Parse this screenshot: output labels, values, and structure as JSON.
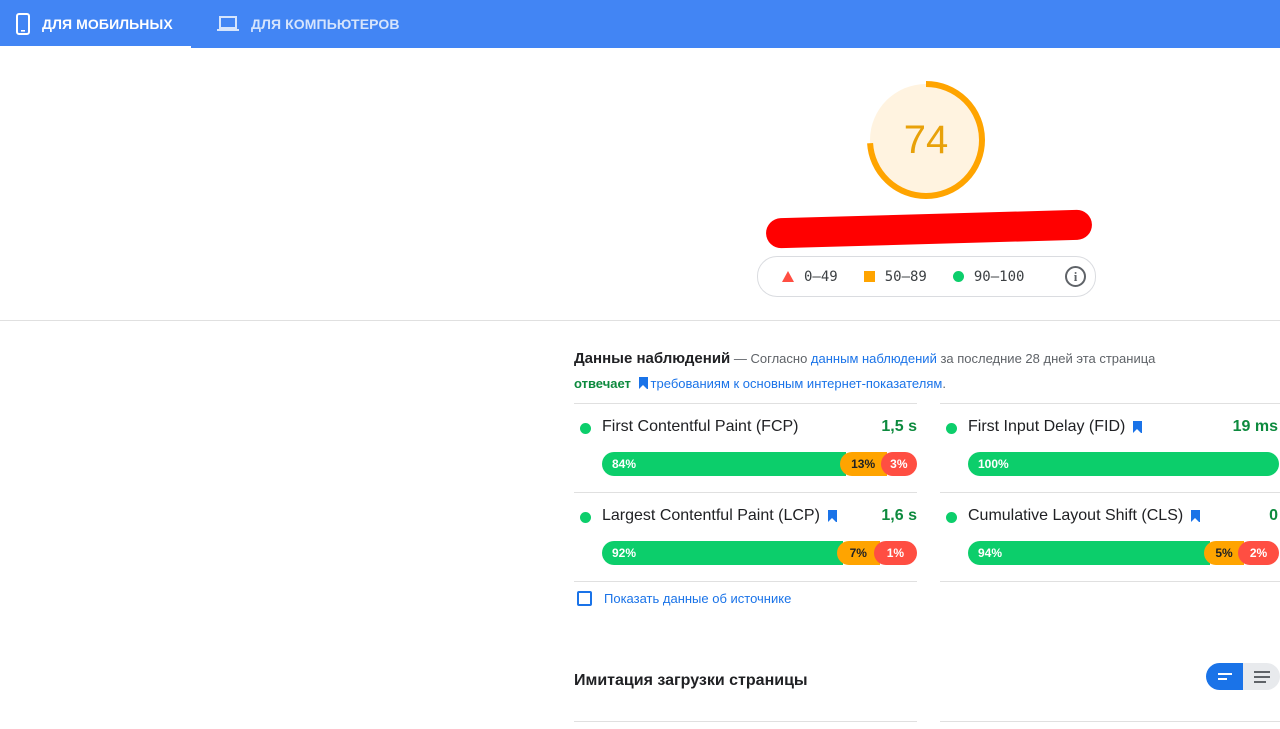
{
  "tabs": {
    "mobile_label": "ДЛЯ МОБИЛЬНЫХ",
    "desktop_label": "ДЛЯ КОМПЬЮТЕРОВ"
  },
  "score": {
    "value": "74",
    "fraction": 0.74,
    "color": "#ffa400"
  },
  "legend": {
    "fail": "0–49",
    "average": "50–89",
    "pass": "90–100",
    "info_icon": "info-icon"
  },
  "field_data": {
    "title": "Данные наблюдений",
    "intro_dash": " — Согласно ",
    "link_text": "данным наблюдений",
    "after_link": " за последние 28 дней эта страница",
    "verdict": "отвечает",
    "requirements_link": "требованиям к основным интернет-показателям",
    "period": "."
  },
  "metrics": [
    {
      "name": "First Contentful Paint (FCP)",
      "value": "1,5 s",
      "core": false,
      "good": "84%",
      "avg": "13%",
      "poor": "3%"
    },
    {
      "name": "First Input Delay (FID)",
      "value": "19 ms",
      "core": true,
      "good": "100%",
      "avg": "",
      "poor": ""
    },
    {
      "name": "Largest Contentful Paint (LCP)",
      "value": "1,6 s",
      "core": true,
      "good": "92%",
      "avg": "7%",
      "poor": "1%"
    },
    {
      "name": "Cumulative Layout Shift (CLS)",
      "value": "0",
      "core": true,
      "good": "94%",
      "avg": "5%",
      "poor": "2%"
    }
  ],
  "origin_checkbox_label": "Показать данные об источнике",
  "lab": {
    "title": "Имитация загрузки страницы"
  },
  "colors": {
    "header": "#4285f4",
    "good": "#0cce6b",
    "average": "#ffa400",
    "poor": "#ff4e42",
    "link": "#1a73e8"
  }
}
